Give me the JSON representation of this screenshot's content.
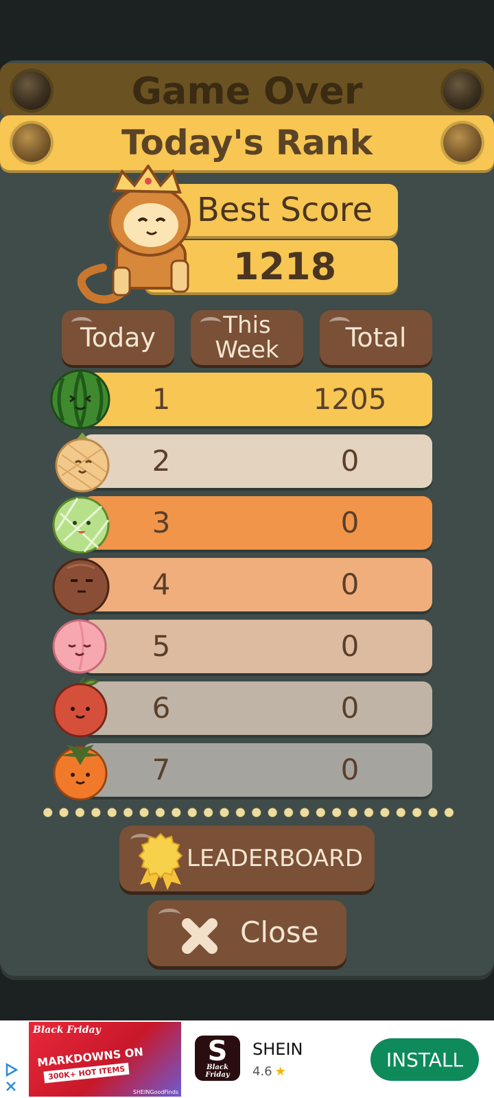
{
  "header": {
    "title": "Game Over",
    "subtitle": "Today's Rank"
  },
  "best": {
    "label": "Best Score",
    "value": "1218"
  },
  "tabs": [
    {
      "label": "Today"
    },
    {
      "label": "This Week"
    },
    {
      "label": "Total"
    }
  ],
  "ranks": [
    {
      "rank": "1",
      "score": "1205",
      "fruit": "watermelon-icon",
      "color": "#f7c653"
    },
    {
      "rank": "2",
      "score": "0",
      "fruit": "pineapple-icon",
      "color": "#e3d3bf"
    },
    {
      "rank": "3",
      "score": "0",
      "fruit": "melon-icon",
      "color": "#f0954a"
    },
    {
      "rank": "4",
      "score": "0",
      "fruit": "coconut-icon",
      "color": "#f0ae7d"
    },
    {
      "rank": "5",
      "score": "0",
      "fruit": "peach-icon",
      "color": "#dcbba0"
    },
    {
      "rank": "6",
      "score": "0",
      "fruit": "apple-icon",
      "color": "#c0b4a6"
    },
    {
      "rank": "7",
      "score": "0",
      "fruit": "persimmon-icon",
      "color": "#a6a49f"
    }
  ],
  "buttons": {
    "leaderboard": "LEADERBOARD",
    "close": "Close"
  },
  "ad": {
    "banner_title": "Black Friday",
    "banner_headline": "MARKDOWNS ON",
    "banner_hot": "300K+ HOT ITEMS",
    "banner_tag": "SHEINGoodFinds",
    "logo_letter": "S",
    "logo_caption": "Black Friday",
    "app_name": "SHEIN",
    "rating": "4.6",
    "install": "INSTALL"
  }
}
